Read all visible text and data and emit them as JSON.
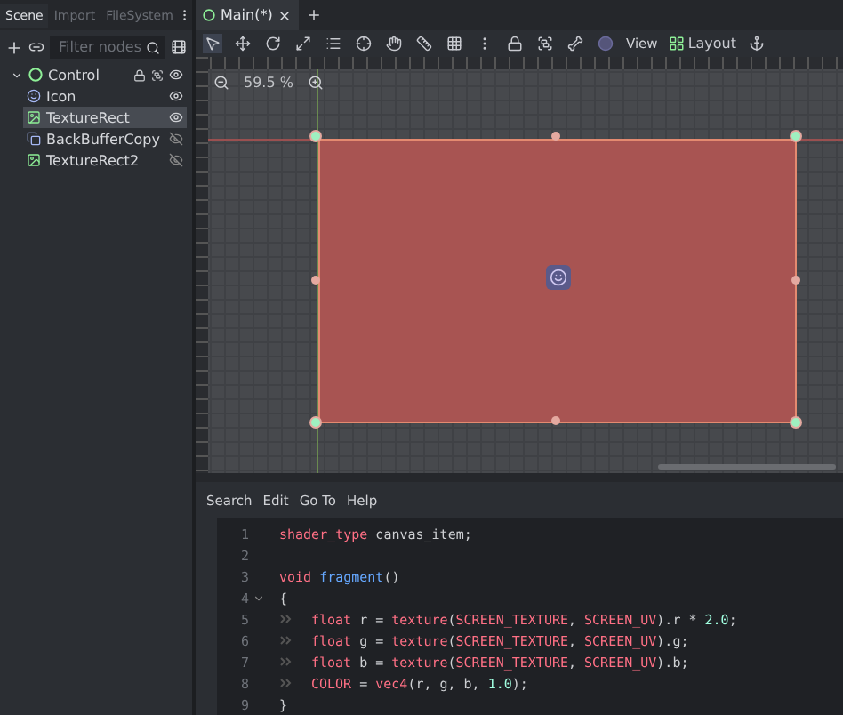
{
  "scene_tabs": [
    {
      "label": "Scene",
      "selected": true
    },
    {
      "label": "Import",
      "selected": false
    },
    {
      "label": "FileSystem",
      "selected": false
    }
  ],
  "filter": {
    "placeholder": "Filter nodes"
  },
  "tree": [
    {
      "label": "Control",
      "kind": "control",
      "visible": true,
      "expanded": true,
      "selected": false,
      "children": [
        {
          "label": "Icon",
          "kind": "sprite",
          "visible": true,
          "selected": false
        },
        {
          "label": "TextureRect",
          "kind": "texture",
          "visible": true,
          "selected": true
        },
        {
          "label": "BackBufferCopy",
          "kind": "copy",
          "visible": false,
          "selected": false
        },
        {
          "label": "TextureRect2",
          "kind": "texture",
          "visible": false,
          "selected": false
        }
      ]
    }
  ],
  "editor_tab": {
    "label": "Main(*)"
  },
  "toolbar": {
    "view": "View",
    "layout": "Layout"
  },
  "zoom": "59.5 %",
  "code_menu": [
    "Search",
    "Edit",
    "Go To",
    "Help"
  ],
  "code": [
    {
      "number": "1",
      "tokens": [
        {
          "kind": "keyword",
          "text": "shader_type"
        },
        {
          "kind": "plain",
          "text": " canvas_item;"
        }
      ]
    },
    {
      "number": "2"
    },
    {
      "number": "3",
      "tokens": [
        {
          "kind": "keyword",
          "text": "void"
        },
        {
          "kind": "func",
          "text": " fragment"
        },
        {
          "kind": "plain",
          "text": "()"
        }
      ]
    },
    {
      "number": "4",
      "fold": true,
      "tokens": [
        {
          "kind": "plain",
          "text": "{"
        }
      ]
    },
    {
      "number": "5",
      "indent": true,
      "tokens": [
        {
          "kind": "keyword",
          "text": "float"
        },
        {
          "kind": "plain",
          "text": " r = "
        },
        {
          "kind": "keyword",
          "text": "texture"
        },
        {
          "kind": "plain",
          "text": "("
        },
        {
          "kind": "keyword",
          "text": "SCREEN_TEXTURE"
        },
        {
          "kind": "plain",
          "text": ", "
        },
        {
          "kind": "keyword",
          "text": "SCREEN_UV"
        },
        {
          "kind": "plain",
          "text": ").r * "
        },
        {
          "kind": "number",
          "text": "2.0"
        },
        {
          "kind": "plain",
          "text": ";"
        }
      ]
    },
    {
      "number": "6",
      "indent": true,
      "tokens": [
        {
          "kind": "keyword",
          "text": "float"
        },
        {
          "kind": "plain",
          "text": " g = "
        },
        {
          "kind": "keyword",
          "text": "texture"
        },
        {
          "kind": "plain",
          "text": "("
        },
        {
          "kind": "keyword",
          "text": "SCREEN_TEXTURE"
        },
        {
          "kind": "plain",
          "text": ", "
        },
        {
          "kind": "keyword",
          "text": "SCREEN_UV"
        },
        {
          "kind": "plain",
          "text": ").g;"
        }
      ]
    },
    {
      "number": "7",
      "indent": true,
      "tokens": [
        {
          "kind": "keyword",
          "text": "float"
        },
        {
          "kind": "plain",
          "text": " b = "
        },
        {
          "kind": "keyword",
          "text": "texture"
        },
        {
          "kind": "plain",
          "text": "("
        },
        {
          "kind": "keyword",
          "text": "SCREEN_TEXTURE"
        },
        {
          "kind": "plain",
          "text": ", "
        },
        {
          "kind": "keyword",
          "text": "SCREEN_UV"
        },
        {
          "kind": "plain",
          "text": ").b;"
        }
      ]
    },
    {
      "number": "8",
      "indent": true,
      "tokens": [
        {
          "kind": "keyword",
          "text": "COLOR"
        },
        {
          "kind": "plain",
          "text": " = "
        },
        {
          "kind": "keyword",
          "text": "vec4"
        },
        {
          "kind": "plain",
          "text": "(r, g, b, "
        },
        {
          "kind": "number",
          "text": "1.0"
        },
        {
          "kind": "plain",
          "text": ");"
        }
      ]
    },
    {
      "number": "9",
      "tokens": [
        {
          "kind": "plain",
          "text": "}"
        }
      ]
    }
  ]
}
